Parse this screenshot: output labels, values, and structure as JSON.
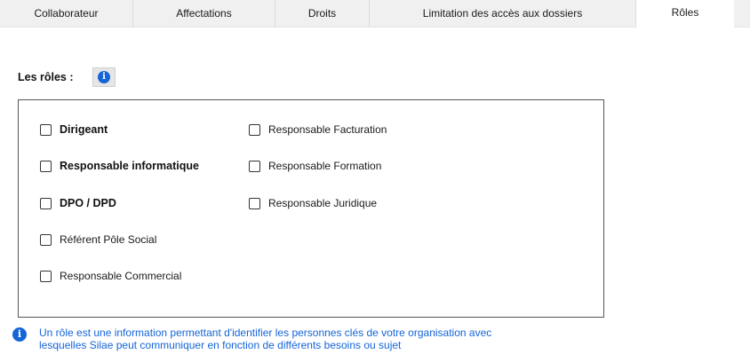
{
  "tabs": [
    {
      "label": "Collaborateur"
    },
    {
      "label": "Affectations"
    },
    {
      "label": "Droits"
    },
    {
      "label": "Limitation des accès aux dossiers"
    },
    {
      "label": "Rôles",
      "active": true
    }
  ],
  "roles": {
    "title": "Les rôles :",
    "info_icon": "info-icon",
    "column1": [
      {
        "label": "Dirigeant",
        "checked": false,
        "bold": true
      },
      {
        "label": "Responsable informatique",
        "checked": false,
        "bold": true
      },
      {
        "label": "DPO / DPD",
        "checked": false,
        "bold": true
      },
      {
        "label": "Référent Pôle Social",
        "checked": false,
        "bold": false
      },
      {
        "label": "Responsable Commercial",
        "checked": false,
        "bold": false
      }
    ],
    "column2": [
      {
        "label": "Responsable Facturation",
        "checked": false
      },
      {
        "label": "Responsable Formation",
        "checked": false
      },
      {
        "label": "Responsable Juridique",
        "checked": false
      }
    ]
  },
  "note": {
    "text_line1": "Un rôle est une information permettant d'identifier les personnes clés de votre organisation avec",
    "text_line2": "lesquelles Silae peut communiquer en fonction de différents besoins ou sujet",
    "icon": "info-icon"
  },
  "colors": {
    "accent": "#1565d8",
    "tabbar_bg": "#f0f0f0"
  }
}
